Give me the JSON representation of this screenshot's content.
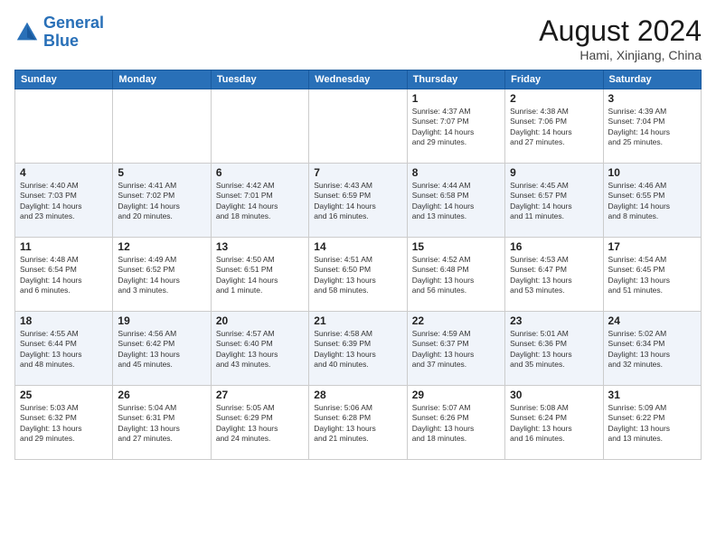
{
  "header": {
    "logo_general": "General",
    "logo_blue": "Blue",
    "month": "August 2024",
    "location": "Hami, Xinjiang, China"
  },
  "weekdays": [
    "Sunday",
    "Monday",
    "Tuesday",
    "Wednesday",
    "Thursday",
    "Friday",
    "Saturday"
  ],
  "weeks": [
    [
      {
        "day": "",
        "info": ""
      },
      {
        "day": "",
        "info": ""
      },
      {
        "day": "",
        "info": ""
      },
      {
        "day": "",
        "info": ""
      },
      {
        "day": "1",
        "info": "Sunrise: 4:37 AM\nSunset: 7:07 PM\nDaylight: 14 hours\nand 29 minutes."
      },
      {
        "day": "2",
        "info": "Sunrise: 4:38 AM\nSunset: 7:06 PM\nDaylight: 14 hours\nand 27 minutes."
      },
      {
        "day": "3",
        "info": "Sunrise: 4:39 AM\nSunset: 7:04 PM\nDaylight: 14 hours\nand 25 minutes."
      }
    ],
    [
      {
        "day": "4",
        "info": "Sunrise: 4:40 AM\nSunset: 7:03 PM\nDaylight: 14 hours\nand 23 minutes."
      },
      {
        "day": "5",
        "info": "Sunrise: 4:41 AM\nSunset: 7:02 PM\nDaylight: 14 hours\nand 20 minutes."
      },
      {
        "day": "6",
        "info": "Sunrise: 4:42 AM\nSunset: 7:01 PM\nDaylight: 14 hours\nand 18 minutes."
      },
      {
        "day": "7",
        "info": "Sunrise: 4:43 AM\nSunset: 6:59 PM\nDaylight: 14 hours\nand 16 minutes."
      },
      {
        "day": "8",
        "info": "Sunrise: 4:44 AM\nSunset: 6:58 PM\nDaylight: 14 hours\nand 13 minutes."
      },
      {
        "day": "9",
        "info": "Sunrise: 4:45 AM\nSunset: 6:57 PM\nDaylight: 14 hours\nand 11 minutes."
      },
      {
        "day": "10",
        "info": "Sunrise: 4:46 AM\nSunset: 6:55 PM\nDaylight: 14 hours\nand 8 minutes."
      }
    ],
    [
      {
        "day": "11",
        "info": "Sunrise: 4:48 AM\nSunset: 6:54 PM\nDaylight: 14 hours\nand 6 minutes."
      },
      {
        "day": "12",
        "info": "Sunrise: 4:49 AM\nSunset: 6:52 PM\nDaylight: 14 hours\nand 3 minutes."
      },
      {
        "day": "13",
        "info": "Sunrise: 4:50 AM\nSunset: 6:51 PM\nDaylight: 14 hours\nand 1 minute."
      },
      {
        "day": "14",
        "info": "Sunrise: 4:51 AM\nSunset: 6:50 PM\nDaylight: 13 hours\nand 58 minutes."
      },
      {
        "day": "15",
        "info": "Sunrise: 4:52 AM\nSunset: 6:48 PM\nDaylight: 13 hours\nand 56 minutes."
      },
      {
        "day": "16",
        "info": "Sunrise: 4:53 AM\nSunset: 6:47 PM\nDaylight: 13 hours\nand 53 minutes."
      },
      {
        "day": "17",
        "info": "Sunrise: 4:54 AM\nSunset: 6:45 PM\nDaylight: 13 hours\nand 51 minutes."
      }
    ],
    [
      {
        "day": "18",
        "info": "Sunrise: 4:55 AM\nSunset: 6:44 PM\nDaylight: 13 hours\nand 48 minutes."
      },
      {
        "day": "19",
        "info": "Sunrise: 4:56 AM\nSunset: 6:42 PM\nDaylight: 13 hours\nand 45 minutes."
      },
      {
        "day": "20",
        "info": "Sunrise: 4:57 AM\nSunset: 6:40 PM\nDaylight: 13 hours\nand 43 minutes."
      },
      {
        "day": "21",
        "info": "Sunrise: 4:58 AM\nSunset: 6:39 PM\nDaylight: 13 hours\nand 40 minutes."
      },
      {
        "day": "22",
        "info": "Sunrise: 4:59 AM\nSunset: 6:37 PM\nDaylight: 13 hours\nand 37 minutes."
      },
      {
        "day": "23",
        "info": "Sunrise: 5:01 AM\nSunset: 6:36 PM\nDaylight: 13 hours\nand 35 minutes."
      },
      {
        "day": "24",
        "info": "Sunrise: 5:02 AM\nSunset: 6:34 PM\nDaylight: 13 hours\nand 32 minutes."
      }
    ],
    [
      {
        "day": "25",
        "info": "Sunrise: 5:03 AM\nSunset: 6:32 PM\nDaylight: 13 hours\nand 29 minutes."
      },
      {
        "day": "26",
        "info": "Sunrise: 5:04 AM\nSunset: 6:31 PM\nDaylight: 13 hours\nand 27 minutes."
      },
      {
        "day": "27",
        "info": "Sunrise: 5:05 AM\nSunset: 6:29 PM\nDaylight: 13 hours\nand 24 minutes."
      },
      {
        "day": "28",
        "info": "Sunrise: 5:06 AM\nSunset: 6:28 PM\nDaylight: 13 hours\nand 21 minutes."
      },
      {
        "day": "29",
        "info": "Sunrise: 5:07 AM\nSunset: 6:26 PM\nDaylight: 13 hours\nand 18 minutes."
      },
      {
        "day": "30",
        "info": "Sunrise: 5:08 AM\nSunset: 6:24 PM\nDaylight: 13 hours\nand 16 minutes."
      },
      {
        "day": "31",
        "info": "Sunrise: 5:09 AM\nSunset: 6:22 PM\nDaylight: 13 hours\nand 13 minutes."
      }
    ]
  ]
}
